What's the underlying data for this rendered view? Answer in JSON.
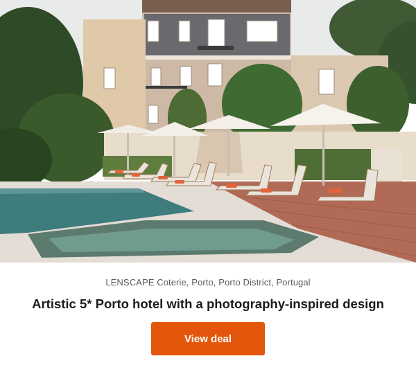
{
  "deal": {
    "image_alt": "Hotel pool terrace with sun loungers and parasols",
    "location": "LENSCAPE Coterie, Porto, Porto District, Portugal",
    "headline": "Artistic 5* Porto hotel with a photography-inspired design",
    "cta_label": "View deal"
  },
  "colors": {
    "cta_background": "#e3560b",
    "cta_text": "#ffffff",
    "headline": "#1b1b1b",
    "location": "#5b5b5b"
  }
}
